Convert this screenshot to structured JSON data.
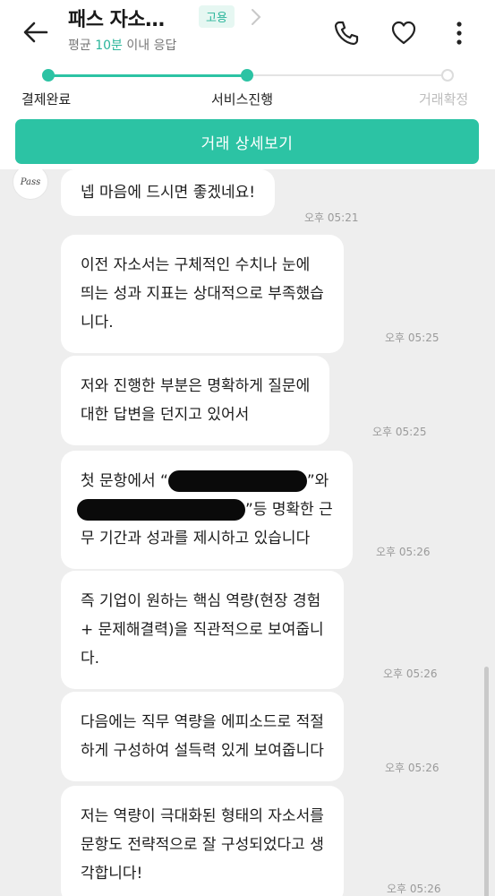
{
  "header": {
    "title": "패스 자소…",
    "badge": "고용",
    "response_prefix": "평균 ",
    "response_value": "10분",
    "response_suffix": " 이내 응답",
    "icons": [
      "back-arrow-icon",
      "chevron-right-icon",
      "phone-icon",
      "heart-icon",
      "more-vertical-icon"
    ]
  },
  "progress": {
    "steps": [
      {
        "label": "결제완료",
        "state": "done"
      },
      {
        "label": "서비스진행",
        "state": "current"
      },
      {
        "label": "거래확정",
        "state": "pending"
      }
    ]
  },
  "detail_button": {
    "label": "거래 상세보기"
  },
  "chat": {
    "avatar_text": "Pass",
    "messages": [
      {
        "lines": [
          "넵 마음에 드시면 좋겠네요!"
        ],
        "time": "오후 05:21"
      },
      {
        "lines": [
          "이전 자소서는 구체적인 수치나 눈에",
          "띄는 성과 지표는 상대적으로 부족했습",
          "니다."
        ],
        "time": "오후 05:25"
      },
      {
        "lines": [
          "저와 진행한 부분은 명확하게 질문에",
          "대한 답변을 던지고 있어서"
        ],
        "time": "오후 05:25"
      },
      {
        "lines": [
          "첫 문항에서 “",
          "”와",
          "”등 명확한 근",
          "무 기간과 성과를 제시하고 있습니다"
        ],
        "time": "오후 05:26"
      },
      {
        "lines": [
          "즉 기업이 원하는 핵심 역량(현장 경험",
          "+ 문제해결력)을 직관적으로 보여줍니",
          "다."
        ],
        "time": "오후 05:26"
      },
      {
        "lines": [
          "다음에는 직무 역량을 에피소드로 적절",
          "하게 구성하여 설득력 있게 보여줍니다"
        ],
        "time": "오후 05:26"
      },
      {
        "lines": [
          "저는 역량이 극대화된 형태의 자소서를",
          "문항도 전략적으로 잘 구성되었다고 생",
          "각합니다!"
        ],
        "time": "오후 05:26"
      }
    ]
  },
  "colors": {
    "accent": "#2cc3a4",
    "chat_bg": "#eeeeee",
    "bubble": "#ffffff",
    "time": "#9a9a9a"
  }
}
